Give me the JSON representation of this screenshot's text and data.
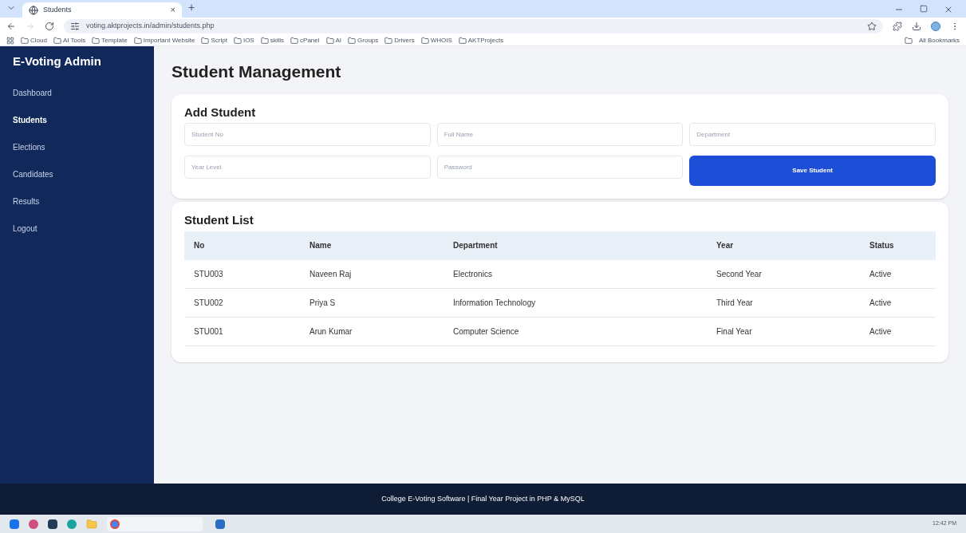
{
  "browser": {
    "tab_title": "Students",
    "tab_close": "×",
    "new_tab": "+",
    "url": "voting.aktprojects.in/admin/students.php",
    "bookmarks": [
      "Cloud",
      "AI Tools",
      "Template",
      "Important Website",
      "Script",
      "IOS",
      "skills",
      "cPanel",
      "AI",
      "Groups",
      "Drivers",
      "WHOIS",
      "AKTProjects"
    ],
    "all_bookmarks": "All Bookmarks"
  },
  "sidebar": {
    "brand": "E-Voting Admin",
    "items": [
      {
        "label": "Dashboard",
        "selected": false
      },
      {
        "label": "Students",
        "selected": true
      },
      {
        "label": "Elections",
        "selected": false
      },
      {
        "label": "Candidates",
        "selected": false
      },
      {
        "label": "Results",
        "selected": false
      },
      {
        "label": "Logout",
        "selected": false
      }
    ]
  },
  "page_title": "Student Management",
  "add_form": {
    "title": "Add Student",
    "fields": [
      {
        "placeholder": "Student No"
      },
      {
        "placeholder": "Full Name"
      },
      {
        "placeholder": "Department"
      },
      {
        "placeholder": "Year Level"
      },
      {
        "placeholder": "Password"
      }
    ],
    "submit": "Save Student"
  },
  "table": {
    "title": "Student List",
    "columns": [
      "No",
      "Name",
      "Department",
      "Year",
      "Status"
    ],
    "rows": [
      [
        "STU003",
        "Naveen Raj",
        "Electronics",
        "Second Year",
        "Active"
      ],
      [
        "STU002",
        "Priya S",
        "Information Technology",
        "Third Year",
        "Active"
      ],
      [
        "STU001",
        "Arun Kumar",
        "Computer Science",
        "Final Year",
        "Active"
      ]
    ]
  },
  "footer": "College E-Voting Software | Final Year Project in PHP & MySQL",
  "taskbar": {
    "time": "12:42 PM"
  }
}
